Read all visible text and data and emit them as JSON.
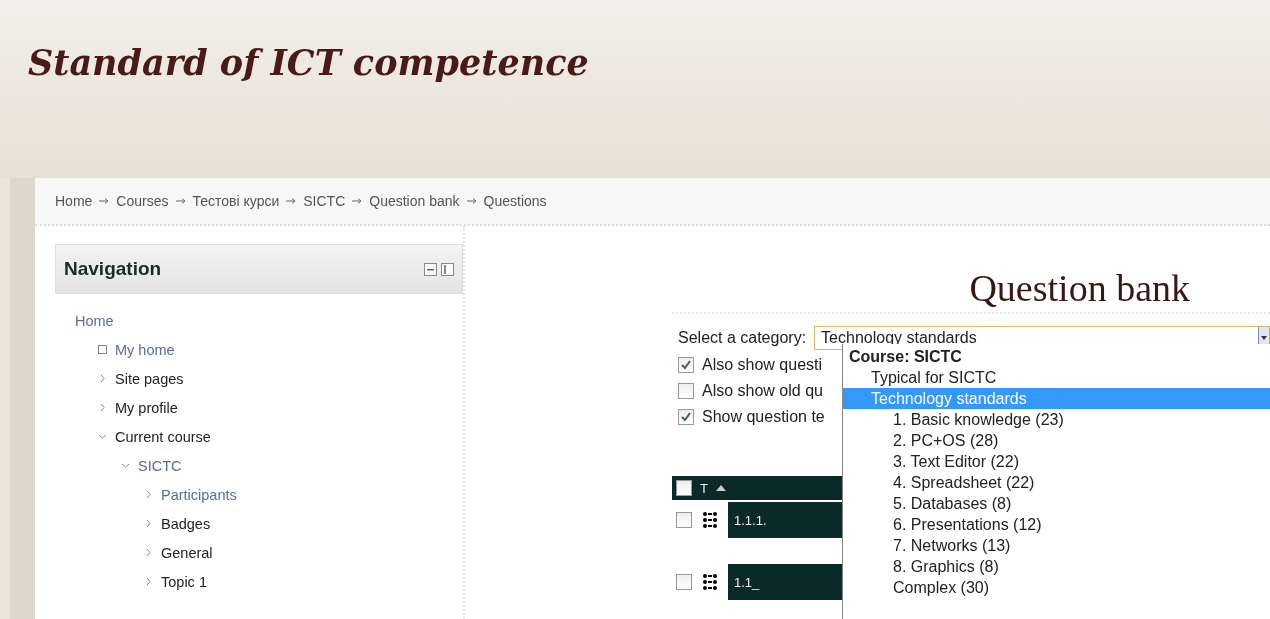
{
  "site_title": "Standard of ICT competence",
  "breadcrumb": [
    "Home",
    "Courses",
    "Тестові курси",
    "SICTC",
    "Question bank",
    "Questions"
  ],
  "navigation": {
    "title": "Navigation",
    "items": [
      {
        "label": "Home",
        "link": true,
        "children": [
          {
            "label": "My home",
            "link": true,
            "kind": "page"
          },
          {
            "label": "Site pages",
            "link": false,
            "kind": "branch",
            "expanded": false
          },
          {
            "label": "My profile",
            "link": false,
            "kind": "branch",
            "expanded": false
          },
          {
            "label": "Current course",
            "link": false,
            "kind": "branch",
            "expanded": true,
            "children": [
              {
                "label": "SICTC",
                "link": true,
                "kind": "branch",
                "expanded": true,
                "children": [
                  {
                    "label": "Participants",
                    "link": true,
                    "kind": "branch",
                    "expanded": false
                  },
                  {
                    "label": "Badges",
                    "link": false,
                    "kind": "branch",
                    "expanded": false
                  },
                  {
                    "label": "General",
                    "link": false,
                    "kind": "branch",
                    "expanded": false
                  },
                  {
                    "label": "Topic 1",
                    "link": false,
                    "kind": "branch",
                    "expanded": false
                  }
                ]
              }
            ]
          }
        ]
      }
    ]
  },
  "main": {
    "heading": "Question bank",
    "category_label": "Select a category:",
    "category_value": "Technology standards",
    "options": [
      {
        "label": "Course: SICTC",
        "kind": "group",
        "children": [
          {
            "label": "Typical for SICTC",
            "selected": false
          },
          {
            "label": "Technology standards",
            "selected": true,
            "children": [
              {
                "label": "1. Basic knowledge (23)",
                "selected": false
              },
              {
                "label": "2. PC+OS (28)",
                "selected": false
              },
              {
                "label": "3. Text Editor (22)",
                "selected": false
              },
              {
                "label": "4. Spreadsheet (22)",
                "selected": false
              },
              {
                "label": "5. Databases (8)",
                "selected": false
              },
              {
                "label": "6. Presentations (12)",
                "selected": false
              },
              {
                "label": "7. Networks (13)",
                "selected": false
              },
              {
                "label": "8. Graphics (8)",
                "selected": false
              },
              {
                "label": "Complex (30)",
                "selected": false
              }
            ]
          }
        ]
      }
    ],
    "checkboxes": [
      {
        "label": "Also show questi",
        "checked": true
      },
      {
        "label": "Also show old qu",
        "checked": false
      },
      {
        "label": "Show question te",
        "checked": true
      }
    ],
    "table": {
      "header": {
        "label": "T",
        "checked": false
      },
      "rows": [
        {
          "name": "1.1.1.",
          "checked": false
        },
        {
          "name": "1.1_",
          "checked": false
        }
      ]
    }
  }
}
